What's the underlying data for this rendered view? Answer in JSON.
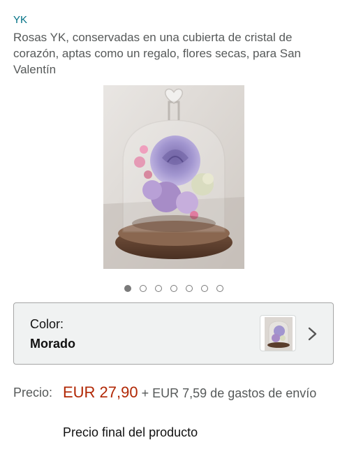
{
  "product": {
    "brand": "YK",
    "title": "Rosas YK, conservadas en una cubierta de cristal de corazón, aptas como un regalo, flores secas, para San Valentín"
  },
  "carousel": {
    "total": 7,
    "active_index": 0
  },
  "variation": {
    "label": "Color:",
    "value": "Morado"
  },
  "price": {
    "label": "Precio:",
    "amount": "EUR 27,90",
    "shipping": " + EUR 7,59 de gastos de envío",
    "note": "Precio final del producto"
  },
  "colors": {
    "link": "#007185",
    "price": "#b12704",
    "rose": "#9b8ec4",
    "base": "#6b4a35"
  }
}
